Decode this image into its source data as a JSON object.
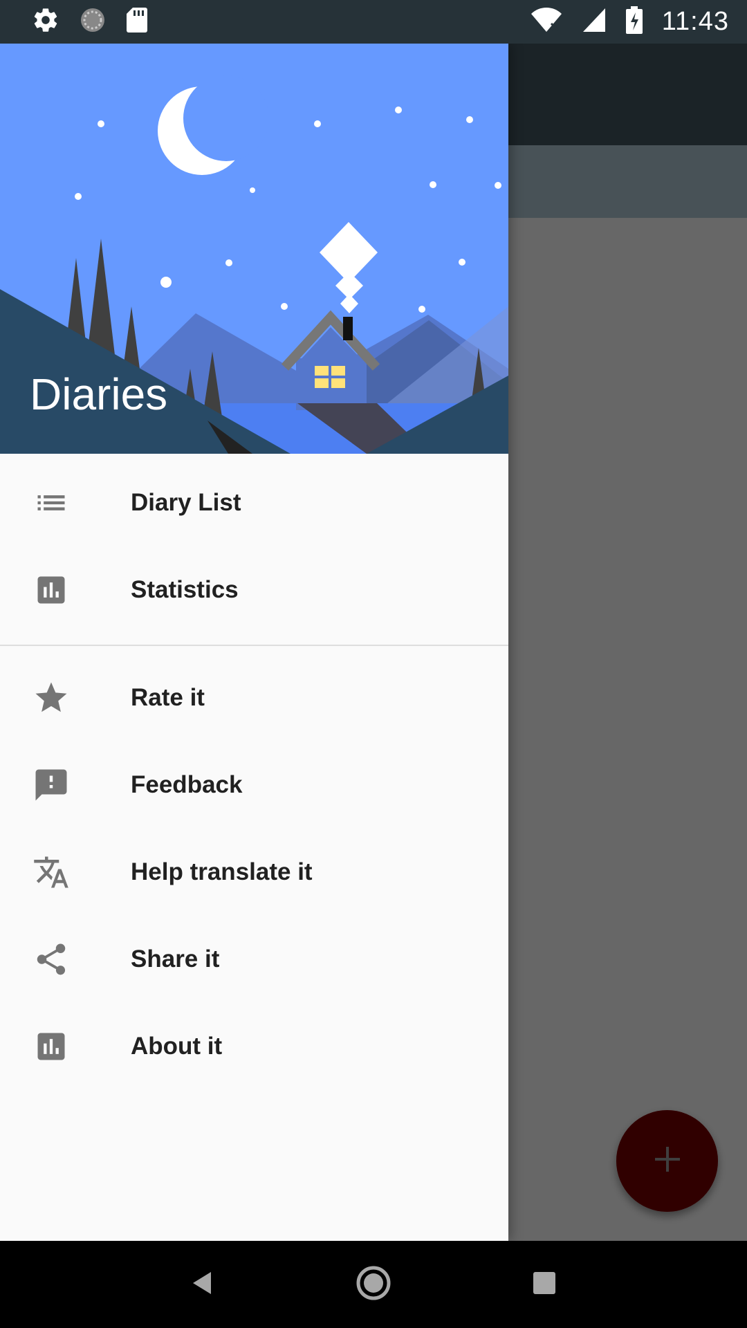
{
  "status_bar": {
    "time": "11:43",
    "icons_left": [
      "settings-icon",
      "sync-icon",
      "sd-card-icon"
    ],
    "icons_right": [
      "wifi-icon",
      "signal-icon",
      "battery-charging-icon"
    ]
  },
  "drawer": {
    "title": "Diaries",
    "primary_items": [
      {
        "label": "Diary List",
        "icon": "list-icon"
      },
      {
        "label": "Statistics",
        "icon": "bar-chart-icon"
      }
    ],
    "secondary_items": [
      {
        "label": "Rate it",
        "icon": "star-icon"
      },
      {
        "label": "Feedback",
        "icon": "feedback-icon"
      },
      {
        "label": "Help translate it",
        "icon": "translate-icon"
      },
      {
        "label": "Share it",
        "icon": "share-icon"
      },
      {
        "label": "About it",
        "icon": "bar-chart-icon"
      }
    ]
  },
  "fab": {
    "icon": "plus-icon",
    "color": "#C00000"
  },
  "nav_bar": {
    "buttons": [
      "back-icon",
      "home-icon",
      "recents-icon"
    ]
  },
  "colors": {
    "status_bar": "#263238",
    "header_sky": "#6699FF",
    "scrim": "rgba(0,0,0,0.5)"
  }
}
